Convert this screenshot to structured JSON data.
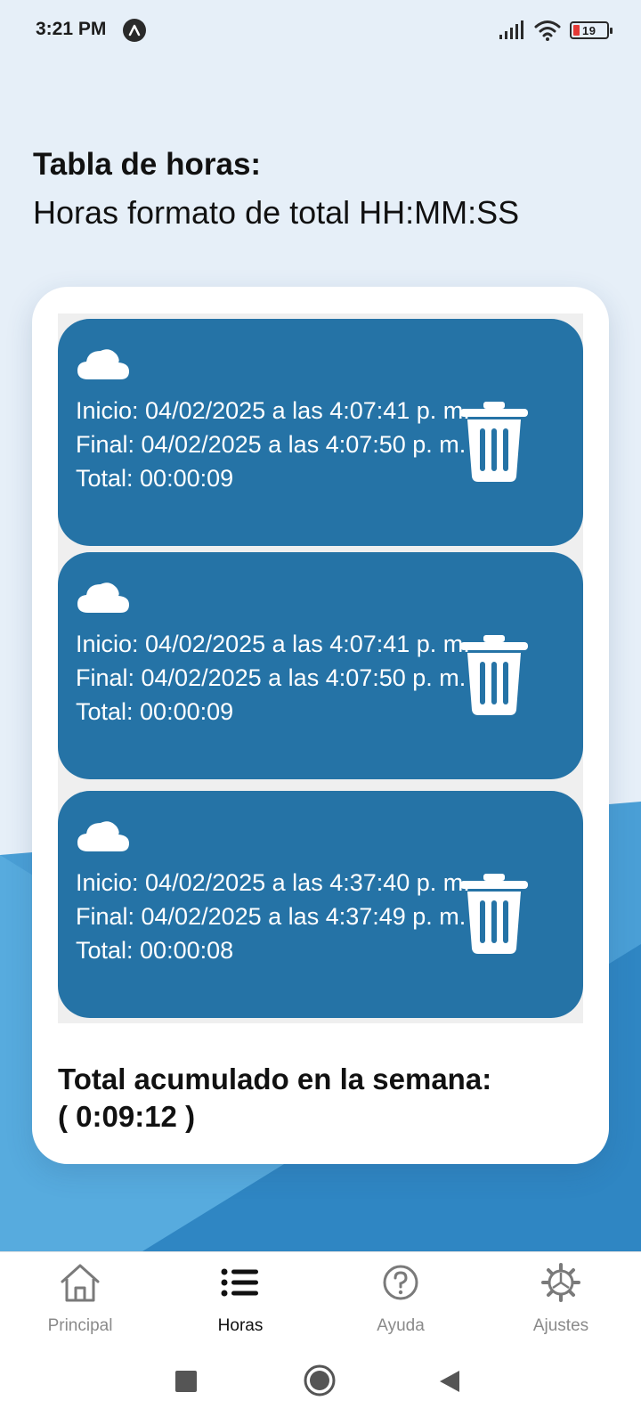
{
  "status_bar": {
    "time": "3:21 PM",
    "battery_level": "19",
    "icons": [
      "app-notification-icon",
      "signal-icon",
      "wifi-icon",
      "battery-icon"
    ]
  },
  "header": {
    "title": "Tabla de horas:",
    "subtitle": "Horas formato de total HH:MM:SS"
  },
  "records": [
    {
      "icon": "cloud-icon",
      "inicio": "Inicio: 04/02/2025 a las 4:07:41 p. m.",
      "final": "Final: 04/02/2025 a las 4:07:50 p. m.",
      "total": "Total: 00:00:09"
    },
    {
      "icon": "cloud-icon",
      "inicio": "Inicio: 04/02/2025 a las 4:07:41 p. m.",
      "final": "Final: 04/02/2025 a las 4:07:50 p. m.",
      "total": "Total: 00:00:09"
    },
    {
      "icon": "cloud-icon",
      "inicio": "Inicio: 04/02/2025 a las 4:37:40 p. m.",
      "final": "Final: 04/02/2025 a las 4:37:49 p. m.",
      "total": "Total: 00:00:08"
    }
  ],
  "summary": {
    "label": "Total acumulado en la semana:",
    "value": "( 0:09:12 )"
  },
  "bottom_nav": {
    "items": [
      {
        "label": "Principal",
        "icon": "home-icon",
        "active": false
      },
      {
        "label": "Horas",
        "icon": "list-icon",
        "active": true
      },
      {
        "label": "Ayuda",
        "icon": "help-icon",
        "active": false
      },
      {
        "label": "Ajustes",
        "icon": "gear-icon",
        "active": false
      }
    ]
  },
  "colors": {
    "background": "#e6eff8",
    "accent_blue": "#2573a6",
    "card": "#ffffff",
    "active_nav": "#111111",
    "inactive_nav": "#8a8a8a"
  }
}
